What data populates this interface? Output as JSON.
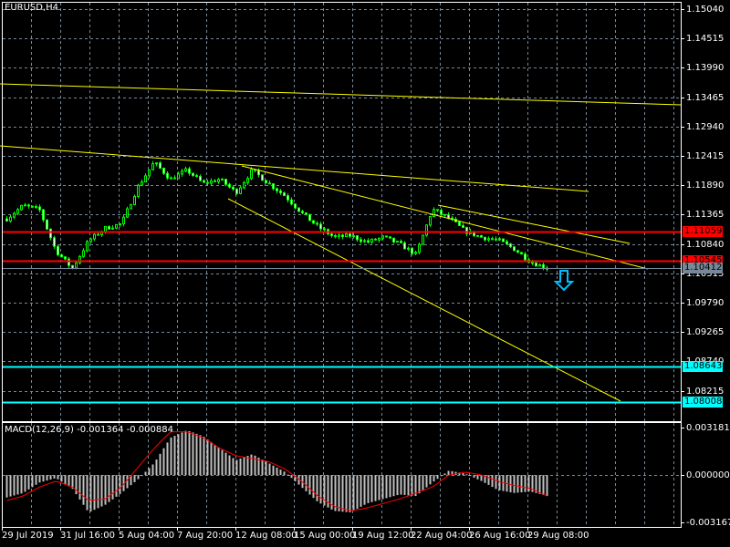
{
  "window": {
    "symbol_title": "EURUSD,H4"
  },
  "price_axis": {
    "ticks": [
      "1.15040",
      "1.14515",
      "1.13990",
      "1.13465",
      "1.12940",
      "1.12415",
      "1.11890",
      "1.11365",
      "1.10840",
      "1.10315",
      "1.09790",
      "1.09265",
      "1.08740",
      "1.08215"
    ],
    "tick_values": [
      1.1504,
      1.14515,
      1.1399,
      1.13465,
      1.1294,
      1.12415,
      1.1189,
      1.11365,
      1.1084,
      1.10315,
      1.0979,
      1.09265,
      1.0874,
      1.08215
    ]
  },
  "levels": [
    {
      "label": "1.11059",
      "value": 1.11059,
      "color": "#ff0000",
      "text_color": "#000000"
    },
    {
      "label": "1.10545",
      "value": 1.10545,
      "color": "#ff0000",
      "text_color": "#000000"
    },
    {
      "label": "1.10412",
      "value": 1.10412,
      "color": "#778899",
      "text_color": "#000000"
    },
    {
      "label": "1.08643",
      "value": 1.08643,
      "color": "#00ffff",
      "text_color": "#000000"
    },
    {
      "label": "1.08008",
      "value": 1.08008,
      "color": "#00ffff",
      "text_color": "#000000"
    }
  ],
  "time_axis": {
    "labels": [
      "29 Jul 2019",
      "31 Jul 16:00",
      "5 Aug 04:00",
      "7 Aug 20:00",
      "12 Aug 08:00",
      "15 Aug 00:00",
      "19 Aug 12:00",
      "22 Aug 04:00",
      "26 Aug 16:00",
      "29 Aug 08:00"
    ]
  },
  "price_path": [
    1.1129,
    1.1153,
    1.1145,
    1.1072,
    1.104,
    1.109,
    1.1112,
    1.112,
    1.1186,
    1.123,
    1.12,
    1.1216,
    1.1192,
    1.12,
    1.1176,
    1.1216,
    1.1192,
    1.117,
    1.114,
    1.1115,
    1.1096,
    1.1099,
    1.1087,
    1.1096,
    1.1084,
    1.1065,
    1.1146,
    1.113,
    1.1107,
    1.1096,
    1.1091,
    1.1075,
    1.1052,
    1.1041
  ],
  "macd": {
    "title": "MACD(12,26,9) -0.001364 -0.000884",
    "axis_labels": [
      "0.003181",
      "0.000000",
      "-0.003167"
    ],
    "range": [
      -0.003167,
      0.003181
    ],
    "histogram_path": [
      -0.0015,
      -0.0012,
      -0.0005,
      -0.0002,
      -0.0009,
      -0.0025,
      -0.002,
      -0.0012,
      -0.0003,
      0.0008,
      0.0025,
      0.003,
      0.0026,
      0.0018,
      0.001,
      0.0014,
      0.0008,
      0.0002,
      -0.0008,
      -0.0018,
      -0.0024,
      -0.0025,
      -0.0019,
      -0.0016,
      -0.0013,
      -0.0014,
      -0.0005,
      0.0003,
      0.0001,
      -0.0004,
      -0.001,
      -0.0012,
      -0.0011,
      -0.0014
    ],
    "signal_path": [
      -0.0017,
      -0.0014,
      -0.0008,
      -0.0004,
      -0.0008,
      -0.0017,
      -0.0016,
      -0.0008,
      0.0005,
      0.0018,
      0.0029,
      0.0029,
      0.0025,
      0.0018,
      0.0013,
      0.0011,
      0.0009,
      0.0004,
      -0.0004,
      -0.0014,
      -0.0021,
      -0.0024,
      -0.0022,
      -0.0019,
      -0.0016,
      -0.0012,
      -0.0008,
      0.0,
      0.0002,
      0.0,
      -0.0004,
      -0.0007,
      -0.0009,
      -0.0014
    ],
    "histogram_color": "#c0c0c0",
    "signal_color": "#ff0000"
  },
  "colors": {
    "background": "#000000",
    "grid": "#778899",
    "candle": "#00ff00",
    "bear_body": "#ffffff",
    "trendline": "#ffff00",
    "axis": "#ffffff",
    "sell_arrow": "#00bfff"
  },
  "signal": {
    "icon": "down-arrow-icon"
  }
}
